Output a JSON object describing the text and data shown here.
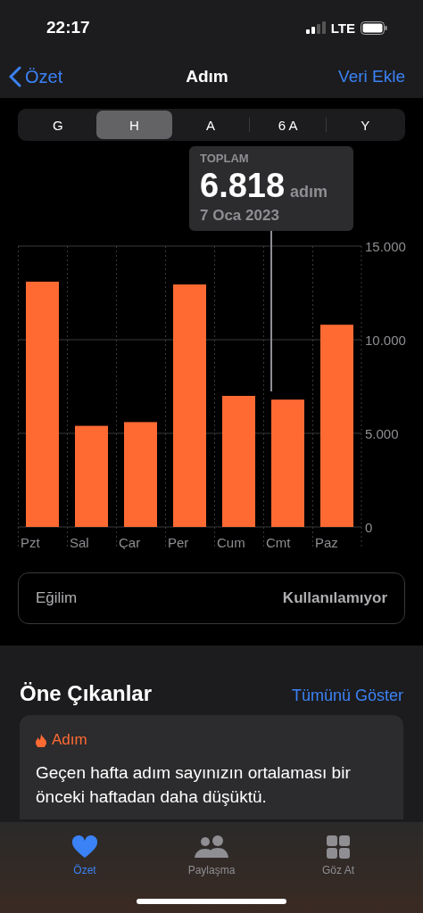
{
  "status_bar": {
    "time": "22:17",
    "network": "LTE"
  },
  "nav": {
    "back": "Özet",
    "title": "Adım",
    "action": "Veri Ekle"
  },
  "segments": [
    {
      "label": "G",
      "selected": false
    },
    {
      "label": "H",
      "selected": true
    },
    {
      "label": "A",
      "selected": false
    },
    {
      "label": "6 A",
      "selected": false
    },
    {
      "label": "Y",
      "selected": false
    }
  ],
  "chart": {
    "chart_data": {
      "type": "bar",
      "categories": [
        "Pzt",
        "Sal",
        "Çar",
        "Per",
        "Cum",
        "Cmt",
        "Paz"
      ],
      "series": [
        {
          "color": "#ff6a33",
          "values": [
            13100,
            5400,
            5600,
            12950,
            7000,
            6800,
            10800
          ]
        }
      ],
      "ylim": [
        0,
        15000
      ],
      "yticks": [
        {
          "value": 0,
          "label": "0"
        },
        {
          "value": 5000,
          "label": "5.000"
        },
        {
          "value": 10000,
          "label": "10.000"
        },
        {
          "value": 15000,
          "label": "15.000"
        }
      ]
    },
    "tooltip": {
      "title": "TOPLAM",
      "value": "6.818",
      "unit": "adım",
      "date": "7 Oca 2023"
    }
  },
  "trend": {
    "label": "Eğilim",
    "value": "Kullanılamıyor"
  },
  "highlights": {
    "title": "Öne Çıkanlar",
    "action": "Tümünü Göster",
    "card": {
      "category": "Adım",
      "text": "Geçen hafta adım sayınızın ortalaması bir önceki haftadan daha düşüktü."
    }
  },
  "tab_bar": [
    {
      "label": "Özet",
      "selected": true
    },
    {
      "label": "Paylaşma",
      "selected": false
    },
    {
      "label": "Göz At",
      "selected": false
    }
  ]
}
